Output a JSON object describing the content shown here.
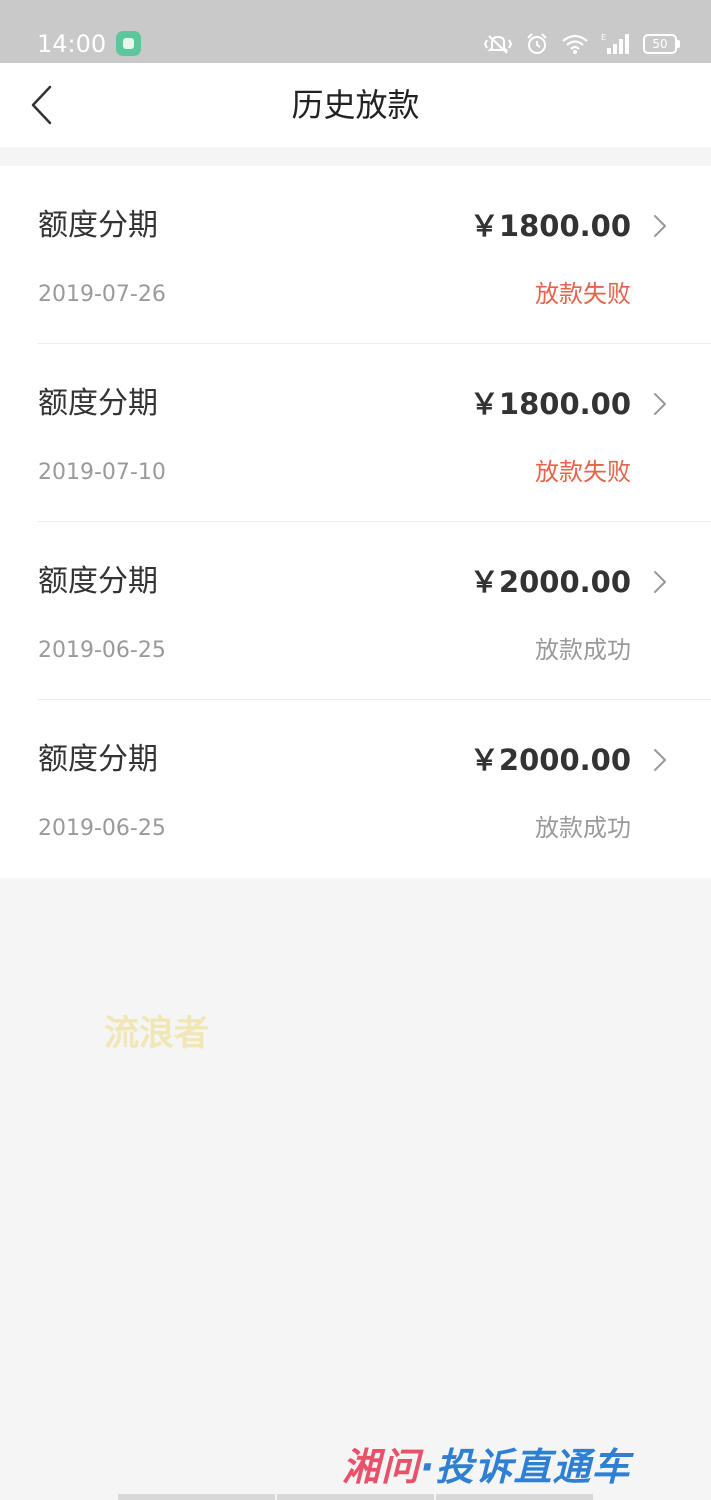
{
  "status_bar": {
    "time": "14:00",
    "battery": "50",
    "icons": [
      "vibrate-mute-icon",
      "alarm-icon",
      "wifi-icon",
      "signal-icon",
      "battery-icon"
    ]
  },
  "nav": {
    "title": "历史放款",
    "back_icon": "chevron-left-icon"
  },
  "records": [
    {
      "title": "额度分期",
      "amount": "￥1800.00",
      "date": "2019-07-26",
      "status": "放款失败"
    },
    {
      "title": "额度分期",
      "amount": "￥1800.00",
      "date": "2019-07-10",
      "status": "放款失败"
    },
    {
      "title": "额度分期",
      "amount": "￥2000.00",
      "date": "2019-06-25",
      "status": "放款成功"
    },
    {
      "title": "额度分期",
      "amount": "￥2000.00",
      "date": "2019-06-25",
      "status": "放款成功"
    }
  ],
  "colors": {
    "status_failed": "#e5624b",
    "status_success": "#9a9a9a",
    "status_bar_bg": "#c9c9c9",
    "page_bg": "#f5f5f5"
  },
  "watermarks": {
    "user": "流浪者",
    "site_part_a": "湘问",
    "site_part_b": "·投诉直通车"
  }
}
